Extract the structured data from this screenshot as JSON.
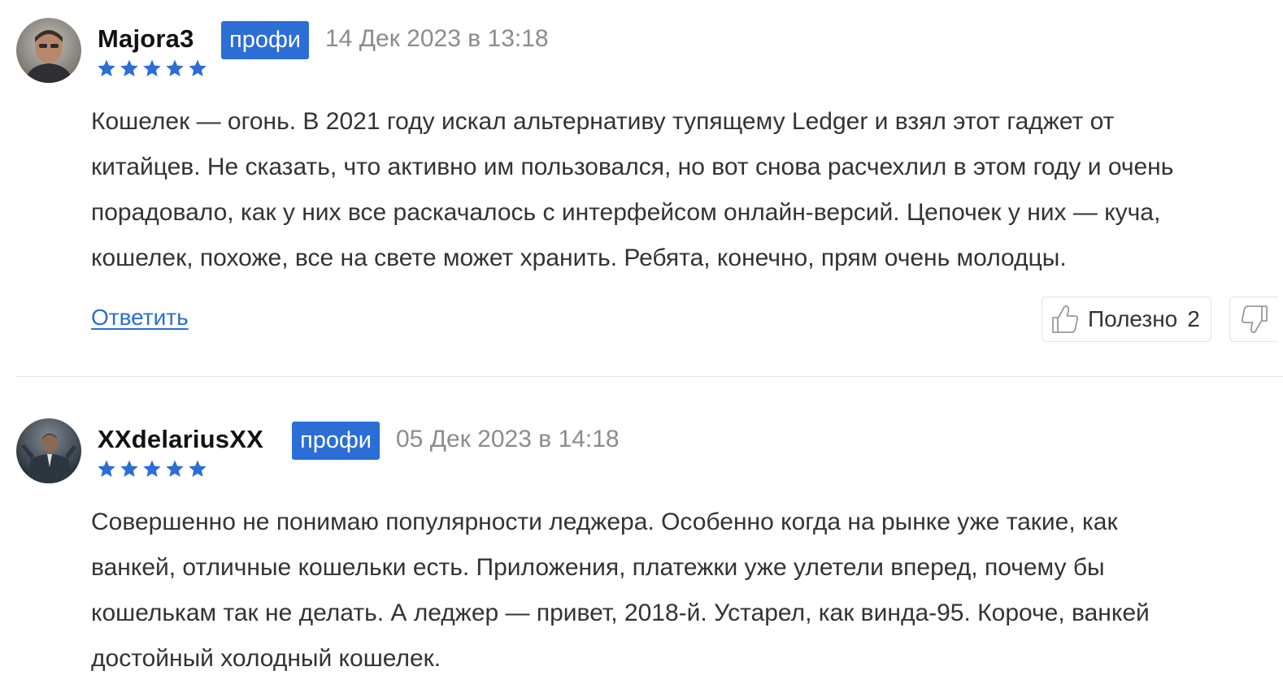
{
  "reviews": [
    {
      "username": "Majora3",
      "badge": "профи",
      "date": "14 Дек 2023 в 13:18",
      "rating": 5,
      "body_lines": [
        "Кошелек — огонь. В 2021 году искал альтернативу тупящему Ledger и взял этот гаджет от",
        "китайцев. Не сказать, что активно им пользовался, но вот снова расчехлил в этом году и очень",
        "порадовало, как у них все раскачалось с интерфейсом онлайн-версий. Цепочек у них — куча,",
        "кошелек, похоже, все на свете может хранить. Ребята, конечно, прям очень молодцы."
      ],
      "reply_label": "Ответить",
      "useful_label": "Полезно",
      "useful_count": "2"
    },
    {
      "username": "XXdelariusXX",
      "badge": "профи",
      "date": "05 Дек 2023 в 14:18",
      "rating": 5,
      "body_lines": [
        "Совершенно не понимаю популярности леджера. Особенно когда на рынке уже такие, как",
        "ванкей, отличные кошельки есть. Приложения, платежки уже улетели вперед, почему бы",
        "кошелькам так не делать. А леджер — привет, 2018-й. Устарел, как винда-95. Короче, ванкей",
        "достойный холодный кошелек."
      ]
    }
  ],
  "colors": {
    "accent": "#2a6ed6",
    "star": "#2a6ed6",
    "date": "#8c8c8c",
    "text": "#333333"
  },
  "icons": {
    "like": "thumbs-up-icon",
    "dislike": "thumbs-down-icon",
    "star": "star-icon"
  }
}
